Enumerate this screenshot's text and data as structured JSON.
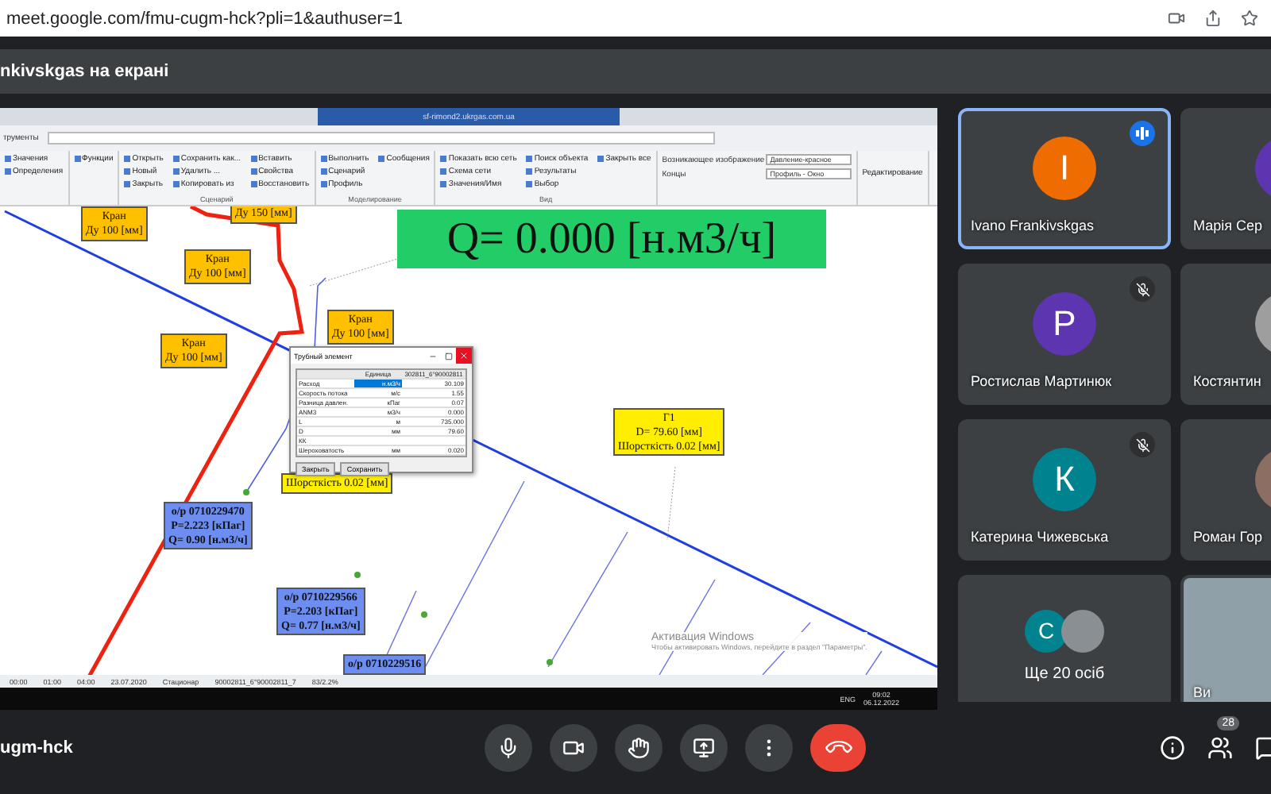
{
  "browser": {
    "url": "meet.google.com/fmu-cugm-hck?pli=1&authuser=1"
  },
  "presenter_bar": {
    "title": "nkivskgas на екрані"
  },
  "shared_screen": {
    "window_title": "sf-rimond2.ukrgas.com.ua",
    "menu_label": "трументы",
    "ribbon": [
      {
        "items": [
          "Значения",
          "Определения"
        ]
      },
      {
        "items": [
          "Функции"
        ]
      },
      {
        "label": "Сценарий",
        "items": [
          "Открыть",
          "Новый",
          "Закрыть",
          "Сохранить как...",
          "Удалить ...",
          "Копировать из",
          "Вставить",
          "Свойства",
          "Восстановить"
        ]
      },
      {
        "label": "Моделирование",
        "items": [
          "Выполнить",
          "Сценарий",
          "Профиль",
          "Сообщения"
        ]
      },
      {
        "label": "Вид",
        "items": [
          "Показать всю сеть",
          "Схема сети",
          "Значения/Имя",
          "Поиск объекта",
          "Результаты",
          "Выбор",
          "Закрыть все"
        ]
      }
    ],
    "view_options": [
      {
        "label": "Возникающее изображение",
        "value": "Давление-красное"
      },
      {
        "label": "Концы",
        "value": "Профиль - Окно"
      }
    ],
    "edit_group": "Редактирование",
    "labels": [
      {
        "kind": "valve",
        "lines": [
          "Кран",
          "Ду 100 [мм]"
        ]
      },
      {
        "kind": "valve",
        "lines": [
          "Ду 150 [мм]"
        ]
      },
      {
        "kind": "flow",
        "lines": [
          "Q= 0.000 [н.м3/ч]"
        ]
      },
      {
        "kind": "valve",
        "lines": [
          "Кран",
          "Ду 100 [мм]"
        ]
      },
      {
        "kind": "valve",
        "lines": [
          "Кран",
          "Ду 100 [мм]"
        ]
      },
      {
        "kind": "valve",
        "lines": [
          "Кран",
          "Ду 100 [мм]"
        ]
      },
      {
        "kind": "pipe",
        "lines": [
          "Шорсткість 0.02 [мм]"
        ]
      },
      {
        "kind": "pipe",
        "lines": [
          "Г1",
          "D= 79.60 [мм]",
          "Шорсткість 0.02 [мм]"
        ]
      },
      {
        "kind": "meter",
        "lines": [
          "о/р 0710229470",
          "P=2.223 [кПаг]",
          "Q= 0.90 [н.м3/ч]"
        ]
      },
      {
        "kind": "meter",
        "lines": [
          "о/р 0710229566",
          "P=2.203 [кПаг]",
          "Q= 0.77 [н.м3/ч]"
        ]
      },
      {
        "kind": "meter",
        "lines": [
          "о/р 0710229516"
        ]
      }
    ],
    "dialog": {
      "title": "Трубный элемент",
      "columns": [
        "Единица",
        "302811_6°90002811"
      ],
      "rows": [
        {
          "name": "Расход",
          "unit": "н.м3/ч",
          "value": "30.109",
          "selected": true
        },
        {
          "name": "Скорость потока",
          "unit": "м/с",
          "value": "1.55",
          "selected": false
        },
        {
          "name": "Разница давлен.",
          "unit": "кПаг",
          "value": "0.07",
          "selected": false
        },
        {
          "name": "ANM3",
          "unit": "м3/ч",
          "value": "0.000",
          "selected": false
        },
        {
          "name": "L",
          "unit": "м",
          "value": "735.000",
          "selected": false
        },
        {
          "name": "D",
          "unit": "мм",
          "value": "79.60",
          "selected": false
        },
        {
          "name": "КК",
          "unit": "",
          "value": "",
          "selected": false
        },
        {
          "name": "Шероховатость",
          "unit": "мм",
          "value": "0.020",
          "selected": false
        }
      ],
      "buttons": [
        "Закрыть",
        "Сохранить"
      ]
    },
    "watermark_text": {
      "title": "Активация Windows",
      "body": "Чтобы активировать Windows, перейдите в раздел \"Параметры\"."
    },
    "status_bar": [
      "00:00",
      "01:00",
      "04:00",
      "23.07.2020",
      "Стационар",
      "90002811_6°90002811_7",
      "83/2.2%"
    ],
    "taskbar": {
      "language": "ENG",
      "time": "09:02",
      "date": "06.12.2022"
    }
  },
  "participants": [
    {
      "kind": "avatar",
      "name": "Ivano Frankivskgas",
      "initial": "I",
      "color": "#ef6c00",
      "speaking": true,
      "muted": false,
      "selected": true
    },
    {
      "kind": "avatar",
      "name": "Марія Сер",
      "color": "#5e35b1",
      "speaking": false,
      "muted": false,
      "selected": false
    },
    {
      "kind": "avatar",
      "name": "Ростислав Мартинюк",
      "initial": "Р",
      "color": "#5e35b1",
      "speaking": false,
      "muted": true,
      "selected": false
    },
    {
      "kind": "photo",
      "name": "Костянтин",
      "color": "#9e9e9e",
      "speaking": false,
      "muted": false,
      "selected": false
    },
    {
      "kind": "avatar",
      "name": "Катерина Чижевська",
      "initial": "К",
      "color": "#00838f",
      "speaking": false,
      "muted": true,
      "selected": false
    },
    {
      "kind": "photo",
      "name": "Роман Гор",
      "color": "#8d6e63",
      "speaking": false,
      "muted": false,
      "selected": false
    },
    {
      "kind": "more",
      "name": "Ще 20 осіб",
      "initial": "С",
      "color": "#00838f",
      "speaking": false,
      "muted": false,
      "selected": false
    },
    {
      "kind": "video",
      "name": "Ви",
      "color": "#8fa0a8",
      "speaking": false,
      "muted": false,
      "selected": false
    }
  ],
  "bottom_bar": {
    "meeting_code": "ugm-hck",
    "people_count": "28"
  }
}
